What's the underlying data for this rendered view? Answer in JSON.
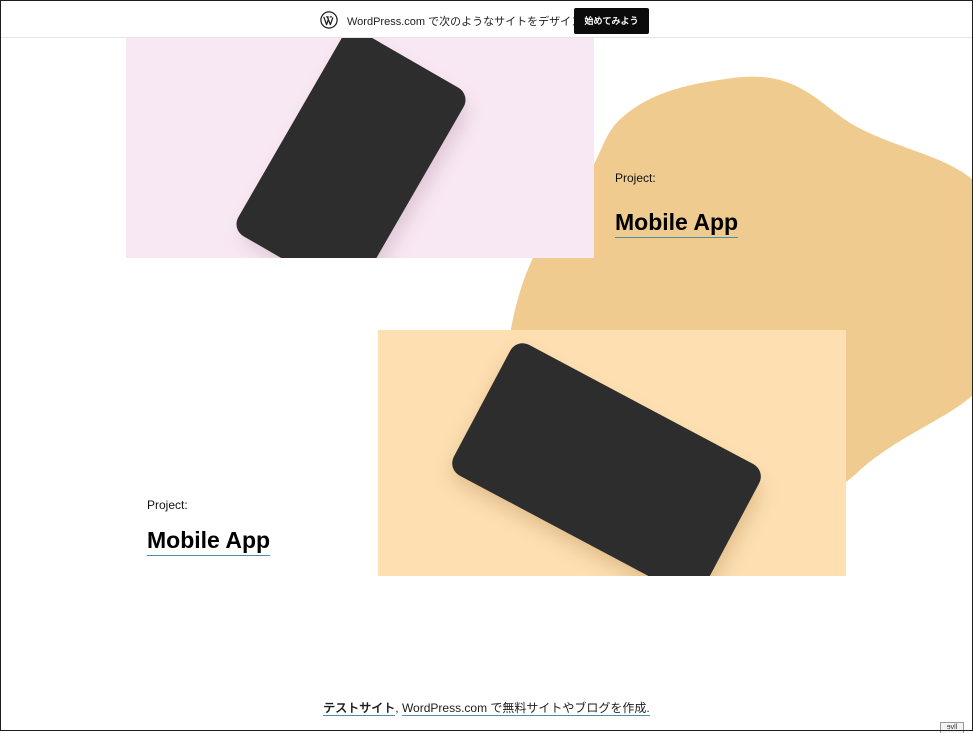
{
  "banner": {
    "text": "WordPress.com で次のようなサイトをデザイン",
    "cta_label": "始めてみよう",
    "logo_icon": "wordpress-logo-icon"
  },
  "colors": {
    "blob": "#f0cb8f",
    "pink_card": "#f8e8f3",
    "peach_card": "#fddfb2",
    "phone": "#2d2d2d",
    "link_underline": "#4f8fa6"
  },
  "projects": [
    {
      "label": "Project:",
      "title": "Mobile App"
    },
    {
      "label": "Project:",
      "title": "Mobile App"
    }
  ],
  "footer": {
    "site_name": "テストサイト",
    "separator": ",",
    "credit": "WordPress.com で無料サイトやブログを作成."
  },
  "corner_widget": {
    "text": "ɘvll"
  }
}
